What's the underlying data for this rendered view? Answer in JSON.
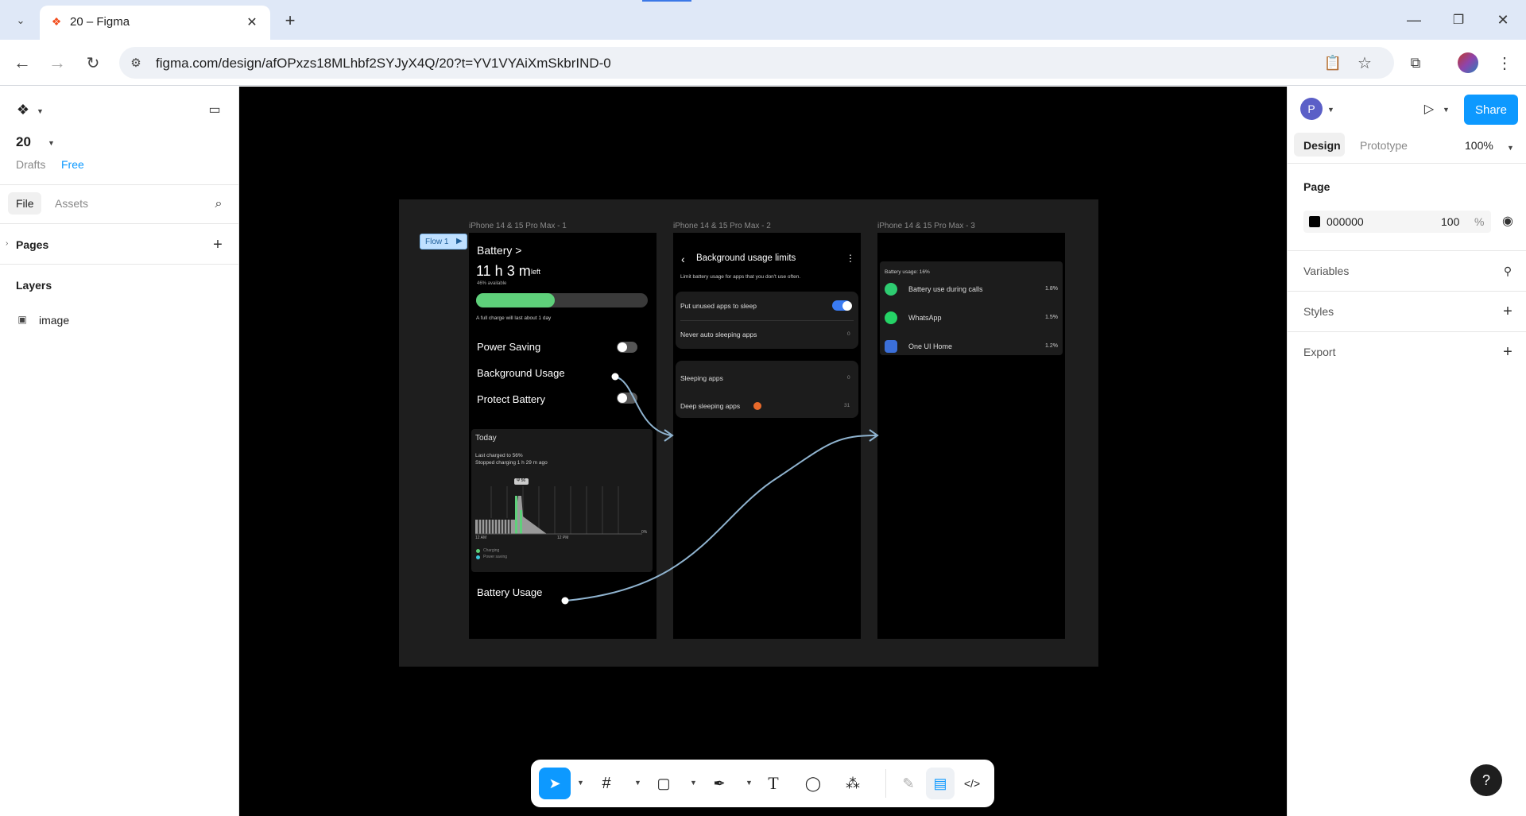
{
  "browser": {
    "tab_title": "20 – Figma",
    "url": "figma.com/design/afOPxzs18MLhbf2SYJyX4Q/20?t=YV1VYAiXmSkbrIND-0"
  },
  "left_panel": {
    "file_name": "20",
    "drafts": "Drafts",
    "plan": "Free",
    "tab_file": "File",
    "tab_assets": "Assets",
    "pages_label": "Pages",
    "layers_label": "Layers",
    "layer_item": "image"
  },
  "right_panel": {
    "avatar_letter": "P",
    "share": "Share",
    "tab_design": "Design",
    "tab_prototype": "Prototype",
    "zoom": "100%",
    "page_label": "Page",
    "page_color": "000000",
    "page_opacity": "100",
    "percent": "%",
    "variables": "Variables",
    "styles": "Styles",
    "export": "Export"
  },
  "design": {
    "flow_label": "Flow 1",
    "frame1_name": "iPhone 14 & 15 Pro Max - 1",
    "frame2_name": "iPhone 14 & 15 Pro Max - 2",
    "frame3_name": "iPhone 14 & 15 Pro Max - 3",
    "battery_title": "Battery >",
    "time_left": "11 h 3 m",
    "left_word": "left",
    "available": "46% available",
    "charge_note": "A full charge will last about 1 day",
    "battery_level": 0.46,
    "power_saving": "Power Saving",
    "background_usage": "Background Usage",
    "protect_battery": "Protect Battery",
    "today": "Today",
    "last_charged": "Last charged to 56%",
    "stopped_charging": "Stopped charging 1 h 29 m ago",
    "chart_peak": "Ψ 56",
    "chart_start": "12 AM",
    "chart_mid": "12 PM",
    "chart_zero": "0%",
    "legend_charging": "Charging",
    "legend_power": "Power saving",
    "battery_usage": "Battery Usage",
    "bg_limits_title": "Background usage limits",
    "bg_limits_desc": "Limit battery usage for apps that you don't use often.",
    "put_unused": "Put unused apps to sleep",
    "never_auto": "Never auto sleeping apps",
    "never_auto_count": "0",
    "sleeping_apps": "Sleeping apps",
    "sleeping_count": "0",
    "deep_sleeping": "Deep sleeping apps",
    "deep_count": "31",
    "usage_header": "Battery usage: 16%",
    "apps": [
      {
        "name": "Battery use during calls",
        "pct": "1.8%",
        "color": "#2ecc71"
      },
      {
        "name": "WhatsApp",
        "pct": "1.5%",
        "color": "#25d366"
      },
      {
        "name": "One UI Home",
        "pct": "1.2%",
        "color": "#3b6fd9"
      }
    ]
  },
  "colors": {
    "accent": "#0d99ff",
    "canvas": "#000000",
    "board": "#1e1e1e",
    "battery_green": "#5ed07a",
    "prototype_line": "#8fb3cf"
  }
}
